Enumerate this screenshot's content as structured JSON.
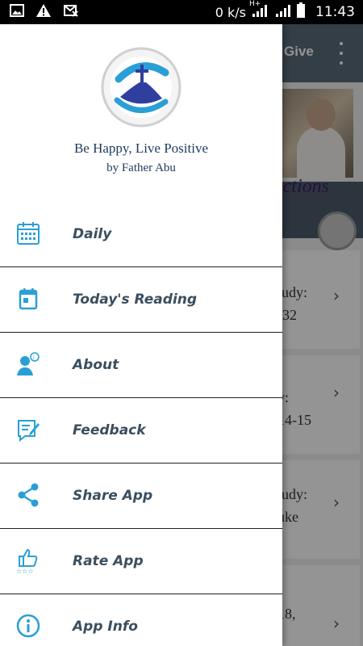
{
  "status_bar": {
    "net_speed": "0 k/s",
    "network_type": "H+",
    "time": "11:43",
    "icons": [
      "image-icon",
      "warning-icon",
      "no-sim-icon",
      "signal-icon",
      "battery-icon"
    ]
  },
  "background_app": {
    "toolbar_title": "Give",
    "banner_text": "ections",
    "cards": [
      {
        "line1": "tudy:",
        "line2": "-32"
      },
      {
        "line1": "y:",
        "line2": "14-15"
      },
      {
        "line1": "tudy:",
        "line2": "uke"
      },
      {
        "line1": "18,",
        "line2": ""
      }
    ]
  },
  "drawer": {
    "tagline": "Be Happy, Live Positive",
    "byline": "by Father Abu",
    "items": [
      {
        "label": "Daily",
        "icon": "calendar-grid-icon"
      },
      {
        "label": "Today's Reading",
        "icon": "calendar-day-icon"
      },
      {
        "label": "About",
        "icon": "person-speaking-icon"
      },
      {
        "label": "Feedback",
        "icon": "edit-note-icon"
      },
      {
        "label": "Share App",
        "icon": "share-icon"
      },
      {
        "label": "Rate App",
        "icon": "thumbs-up-stars-icon"
      },
      {
        "label": "App Info",
        "icon": "info-icon"
      }
    ]
  },
  "colors": {
    "icon_accent": "#2a9fd6",
    "label_color": "#3a4e5f",
    "logo_blue": "#2f3f9e"
  }
}
